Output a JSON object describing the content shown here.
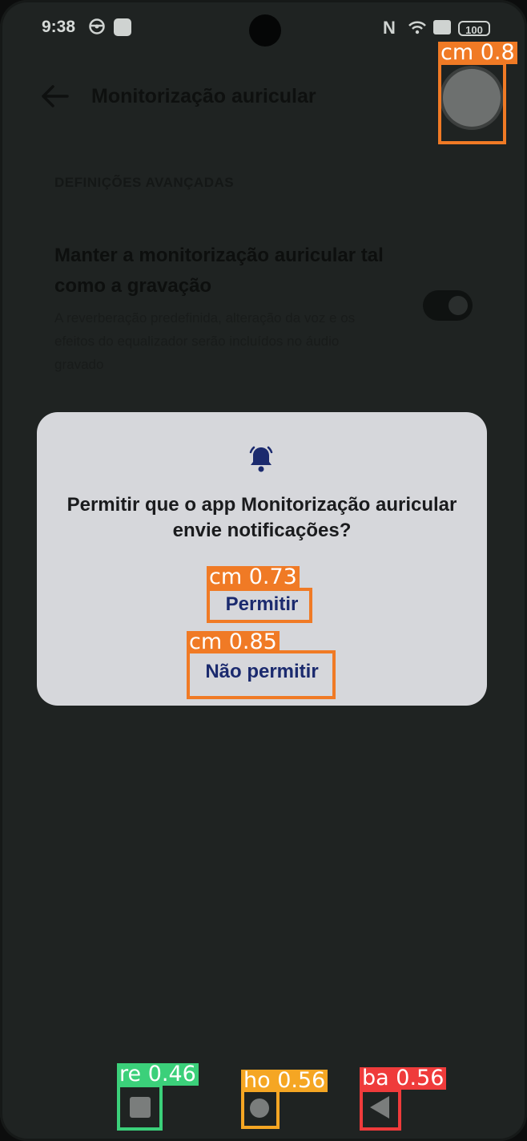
{
  "status_bar": {
    "time": "9:38",
    "battery": "100",
    "nfc_symbol": "N"
  },
  "app": {
    "title": "Monitorização auricular",
    "section_header": "DEFINIÇÕES AVANÇADAS",
    "setting_title": "Manter a monitorização auricular tal como a gravação",
    "setting_description": "A reverberação predefinida, alteração da voz e os efeitos do equalizador serão incluídos no áudio gravado",
    "toggle_state": "on"
  },
  "dialog": {
    "message": "Permitir que o app Monitorização auricular envie notificações?",
    "allow_label": "Permitir",
    "deny_label": "Não permitir",
    "icon": "bell-icon"
  },
  "annotations": {
    "float": "cm 0.8",
    "allow": "cm 0.73",
    "deny": "cm 0.85",
    "recent": "re 0.46",
    "home": "ho 0.56",
    "back": "ba 0.56"
  },
  "colors": {
    "dialog_bg": "#d6d7db",
    "button_text": "#1b2a6e",
    "box_cm": "#f07a25",
    "box_re": "#3bd07a",
    "box_ho": "#f5a623",
    "box_ba": "#ef3b3b"
  }
}
